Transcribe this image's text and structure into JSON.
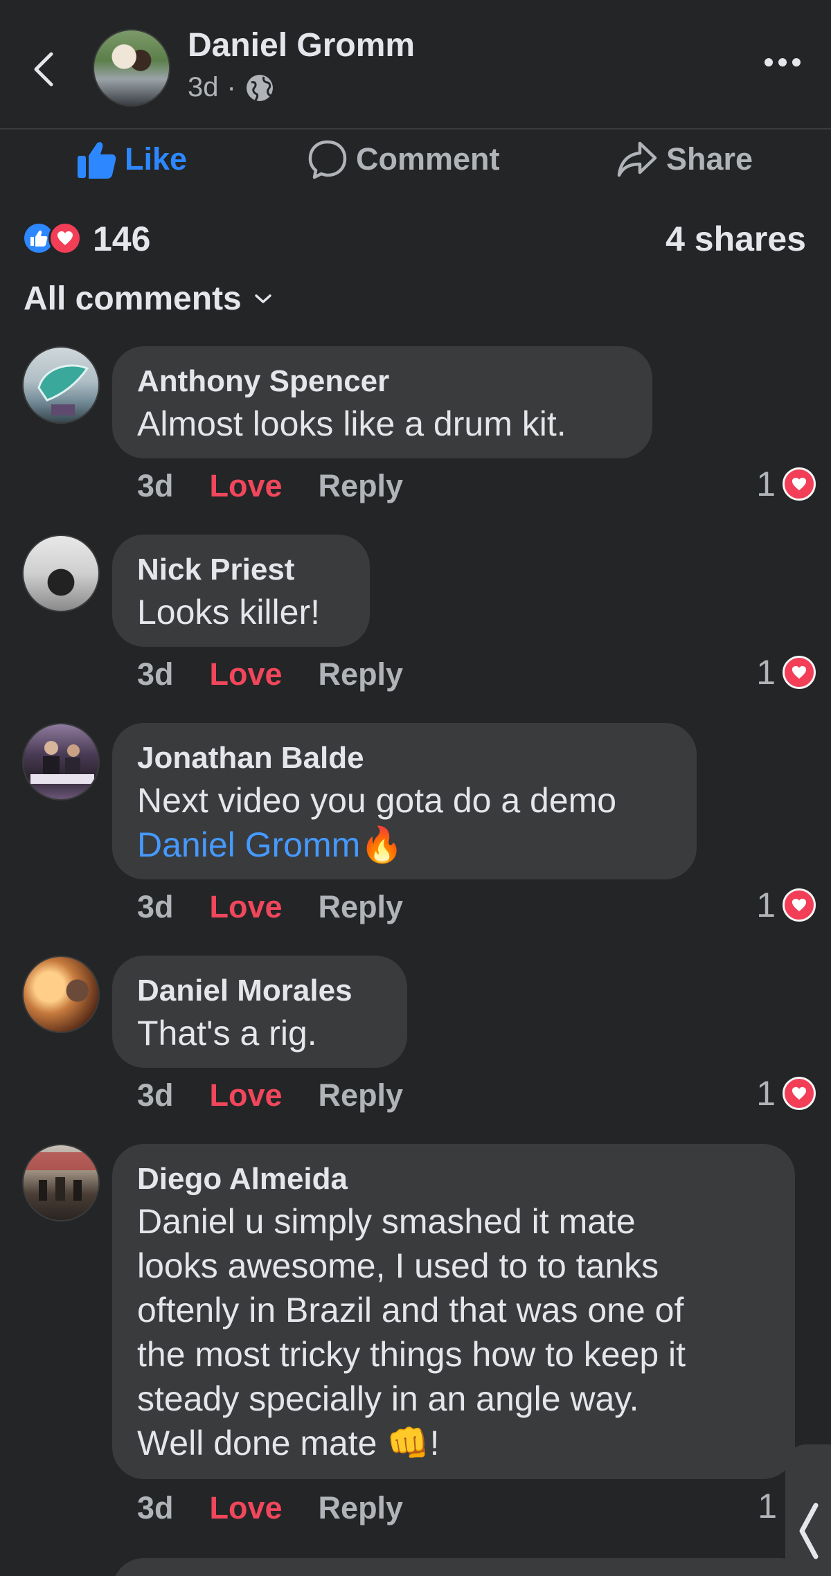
{
  "header": {
    "author_name": "Daniel Gromm",
    "post_time": "3d",
    "separator": "·"
  },
  "actions": {
    "like_label": "Like",
    "comment_label": "Comment",
    "share_label": "Share"
  },
  "stats": {
    "reaction_count": "146",
    "shares": "4 shares"
  },
  "filter": {
    "label": "All comments"
  },
  "comments": [
    {
      "name": "Anthony Spencer",
      "text": "Almost looks like a drum kit.",
      "time": "3d",
      "love_label": "Love",
      "reply_label": "Reply",
      "reaction_count": "1"
    },
    {
      "name": "Nick Priest",
      "text": "Looks killer!",
      "time": "3d",
      "love_label": "Love",
      "reply_label": "Reply",
      "reaction_count": "1"
    },
    {
      "name": "Jonathan Balde",
      "text": "Next video you gota do a demo",
      "mention": "Daniel Gromm",
      "emoji": "🔥",
      "time": "3d",
      "love_label": "Love",
      "reply_label": "Reply",
      "reaction_count": "1"
    },
    {
      "name": "Daniel Morales",
      "text": "That's a rig.",
      "time": "3d",
      "love_label": "Love",
      "reply_label": "Reply",
      "reaction_count": "1"
    },
    {
      "name": "Diego Almeida",
      "lines": [
        "Daniel u simply smashed it mate",
        "looks awesome, I used to to tanks",
        "oftenly in Brazil and that was one of",
        "the most tricky things how to keep it",
        "steady specially in an angle way.",
        "Well done mate 👊!"
      ],
      "time": "3d",
      "love_label": "Love",
      "reply_label": "Reply",
      "reaction_count": "1"
    }
  ],
  "colors": {
    "background": "#242526",
    "bubble": "#3a3b3c",
    "accent_blue": "#2d88ff",
    "love_red": "#f0475c"
  },
  "icons": [
    "back-arrow-icon",
    "globe-icon",
    "more-options-icon",
    "thumbs-up-icon",
    "comment-bubble-icon",
    "share-arrow-icon",
    "like-reaction-icon",
    "love-reaction-icon",
    "chevron-down-icon",
    "chevron-left-icon"
  ]
}
